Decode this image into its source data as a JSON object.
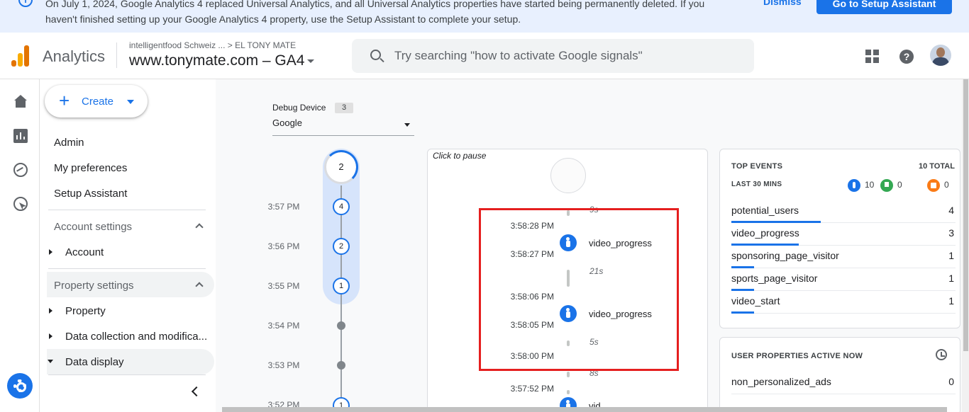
{
  "banner": {
    "message": "On July 1, 2024, Google Analytics 4 replaced Universal Analytics, and all Universal Analytics properties have started being permanently deleted. If you haven't finished setting up your Google Analytics 4 property, use the Setup Assistant to complete your setup.",
    "dismiss_label": "Dismiss",
    "setup_label": "Go to Setup Assistant"
  },
  "header": {
    "app_name": "Analytics",
    "breadcrumb": "intelligentfood Schweiz ... > EL TONY MATE",
    "property": "www.tonymate.com – GA4",
    "search_placeholder": "Try searching \"how to activate Google signals\""
  },
  "nav": {
    "create_label": "Create",
    "links": [
      "Admin",
      "My preferences",
      "Setup Assistant"
    ],
    "account_settings": "Account settings",
    "account_item": "Account",
    "property_settings": "Property settings",
    "property_items": [
      "Property",
      "Data collection and modifica...",
      "Data display"
    ]
  },
  "debug": {
    "device_label": "Debug Device",
    "device_count": "3",
    "device_selected": "Google"
  },
  "minutes": {
    "current_count": "2",
    "rows": [
      {
        "time": "3:57 PM",
        "count": "4"
      },
      {
        "time": "3:56 PM",
        "count": "2"
      },
      {
        "time": "3:55 PM",
        "count": "1"
      },
      {
        "time": "3:54 PM",
        "count": ""
      },
      {
        "time": "3:53 PM",
        "count": ""
      },
      {
        "time": "3:52 PM",
        "count": "1"
      }
    ]
  },
  "stream": {
    "pause_label": "Click to pause",
    "gaps": [
      "9s",
      "21s",
      "5s",
      "8s"
    ],
    "times": [
      "3:58:28 PM",
      "3:58:27 PM",
      "3:58:06 PM",
      "3:58:05 PM",
      "3:58:00 PM",
      "3:57:52 PM"
    ],
    "events": [
      "video_progress",
      "video_progress",
      "vid"
    ]
  },
  "top_events": {
    "title": "TOP EVENTS",
    "total": "10 TOTAL",
    "period": "LAST 30 MINS",
    "stat_events": "10",
    "stat_conversions": "0",
    "stat_errors": "0",
    "rows": [
      {
        "name": "potential_users",
        "count": "4",
        "share": 0.4
      },
      {
        "name": "video_progress",
        "count": "3",
        "share": 0.3
      },
      {
        "name": "sponsoring_page_visitor",
        "count": "1",
        "share": 0.1
      },
      {
        "name": "sports_page_visitor",
        "count": "1",
        "share": 0.1
      },
      {
        "name": "video_start",
        "count": "1",
        "share": 0.1
      }
    ]
  },
  "user_properties": {
    "title": "USER PROPERTIES ACTIVE NOW",
    "rows": [
      {
        "name": "non_personalized_ads",
        "count": "0"
      }
    ]
  },
  "colors": {
    "accent": "#1a73e8",
    "highlight_box": "#e51f1f",
    "logo_orange": "#f9ab00",
    "logo_dark": "#e37400"
  }
}
